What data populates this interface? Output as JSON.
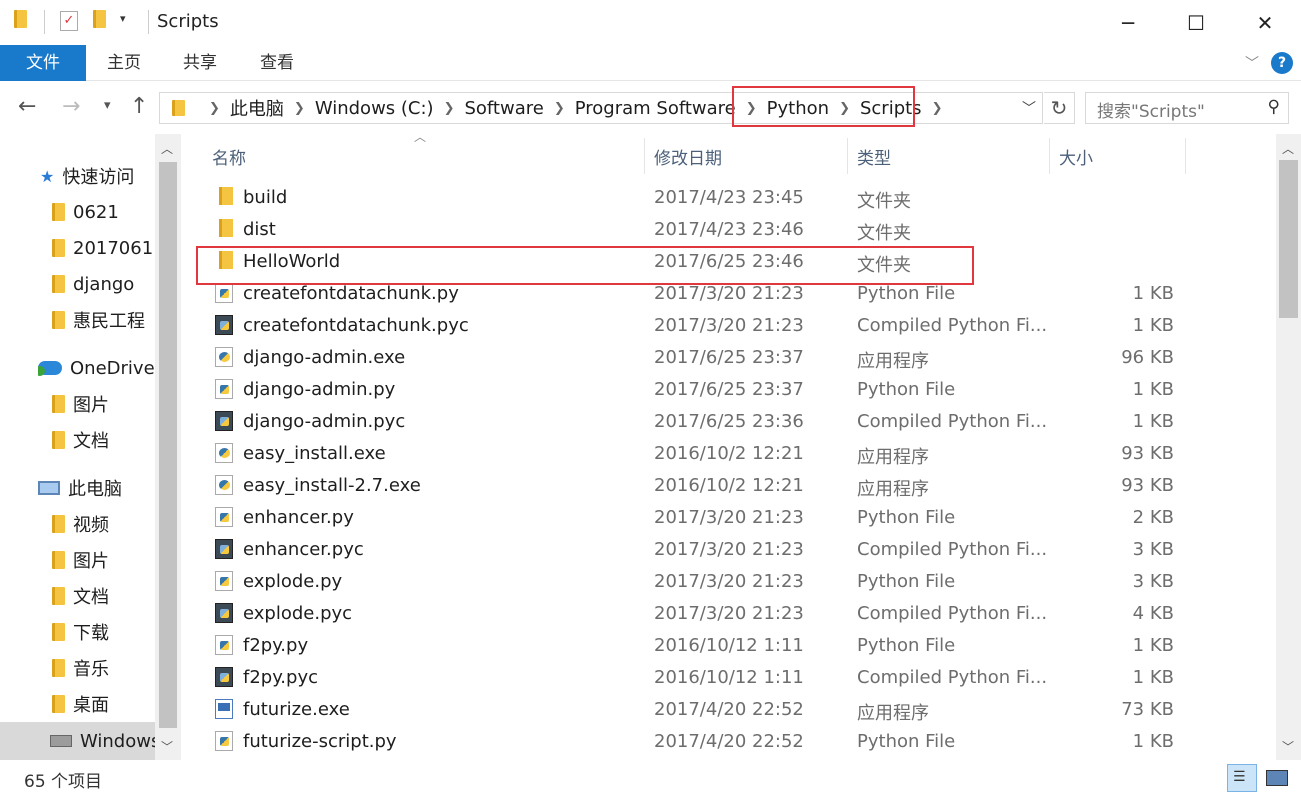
{
  "window": {
    "title": "Scripts",
    "controls": {
      "minimize": "─",
      "maximize": "☐",
      "close": "✕"
    }
  },
  "ribbon": {
    "tabs": [
      {
        "label": "文件",
        "active": true
      },
      {
        "label": "主页"
      },
      {
        "label": "共享"
      },
      {
        "label": "查看"
      }
    ],
    "help": "?"
  },
  "navigation": {
    "breadcrumb": [
      "此电脑",
      "Windows (C:)",
      "Software",
      "Program Software",
      "Python",
      "Scripts"
    ],
    "search_placeholder": "搜索\"Scripts\""
  },
  "nav_pane": [
    {
      "label": "快速访问",
      "icon": "star-icon"
    },
    {
      "label": "0621",
      "icon": "folder-icon"
    },
    {
      "label": "2017061",
      "icon": "folder-icon"
    },
    {
      "label": "django",
      "icon": "folder-icon"
    },
    {
      "label": "惠民工程",
      "icon": "folder-icon"
    },
    {
      "label": "OneDrive",
      "icon": "onedrive-icon"
    },
    {
      "label": "图片",
      "icon": "folder-icon"
    },
    {
      "label": "文档",
      "icon": "folder-icon"
    },
    {
      "label": "此电脑",
      "icon": "pc-icon"
    },
    {
      "label": "视频",
      "icon": "videos-folder-icon"
    },
    {
      "label": "图片",
      "icon": "pictures-folder-icon"
    },
    {
      "label": "文档",
      "icon": "documents-folder-icon"
    },
    {
      "label": "下载",
      "icon": "downloads-folder-icon"
    },
    {
      "label": "音乐",
      "icon": "music-folder-icon"
    },
    {
      "label": "桌面",
      "icon": "desktop-folder-icon"
    },
    {
      "label": "Windows",
      "icon": "drive-icon",
      "selected": true
    }
  ],
  "columns": {
    "name": "名称",
    "date": "修改日期",
    "type": "类型",
    "size": "大小"
  },
  "files": [
    {
      "name": "build",
      "date": "2017/4/23 23:45",
      "type": "文件夹",
      "size": "",
      "icon": "folder"
    },
    {
      "name": "dist",
      "date": "2017/4/23 23:46",
      "type": "文件夹",
      "size": "",
      "icon": "folder"
    },
    {
      "name": "HelloWorld",
      "date": "2017/6/25 23:46",
      "type": "文件夹",
      "size": "",
      "icon": "folder"
    },
    {
      "name": "createfontdatachunk.py",
      "date": "2017/3/20 21:23",
      "type": "Python File",
      "size": "1 KB",
      "icon": "py"
    },
    {
      "name": "createfontdatachunk.pyc",
      "date": "2017/3/20 21:23",
      "type": "Compiled Python Fi...",
      "size": "1 KB",
      "icon": "pyc"
    },
    {
      "name": "django-admin.exe",
      "date": "2017/6/25 23:37",
      "type": "应用程序",
      "size": "96 KB",
      "icon": "exe"
    },
    {
      "name": "django-admin.py",
      "date": "2017/6/25 23:37",
      "type": "Python File",
      "size": "1 KB",
      "icon": "py"
    },
    {
      "name": "django-admin.pyc",
      "date": "2017/6/25 23:36",
      "type": "Compiled Python Fi...",
      "size": "1 KB",
      "icon": "pyc"
    },
    {
      "name": "easy_install.exe",
      "date": "2016/10/2 12:21",
      "type": "应用程序",
      "size": "93 KB",
      "icon": "exe"
    },
    {
      "name": "easy_install-2.7.exe",
      "date": "2016/10/2 12:21",
      "type": "应用程序",
      "size": "93 KB",
      "icon": "exe"
    },
    {
      "name": "enhancer.py",
      "date": "2017/3/20 21:23",
      "type": "Python File",
      "size": "2 KB",
      "icon": "py"
    },
    {
      "name": "enhancer.pyc",
      "date": "2017/3/20 21:23",
      "type": "Compiled Python Fi...",
      "size": "3 KB",
      "icon": "pyc"
    },
    {
      "name": "explode.py",
      "date": "2017/3/20 21:23",
      "type": "Python File",
      "size": "3 KB",
      "icon": "py"
    },
    {
      "name": "explode.pyc",
      "date": "2017/3/20 21:23",
      "type": "Compiled Python Fi...",
      "size": "4 KB",
      "icon": "pyc"
    },
    {
      "name": "f2py.py",
      "date": "2016/10/12 1:11",
      "type": "Python File",
      "size": "1 KB",
      "icon": "py"
    },
    {
      "name": "f2py.pyc",
      "date": "2016/10/12 1:11",
      "type": "Compiled Python Fi...",
      "size": "1 KB",
      "icon": "pyc"
    },
    {
      "name": "futurize.exe",
      "date": "2017/4/20 22:52",
      "type": "应用程序",
      "size": "73 KB",
      "icon": "exe2"
    },
    {
      "name": "futurize-script.py",
      "date": "2017/4/20 22:52",
      "type": "Python File",
      "size": "1 KB",
      "icon": "py"
    }
  ],
  "status": {
    "item_count": "65 个项目"
  },
  "colors": {
    "accent": "#1979ca",
    "highlight_box": "#e0383e",
    "selected_bg": "#d9d9d9"
  }
}
